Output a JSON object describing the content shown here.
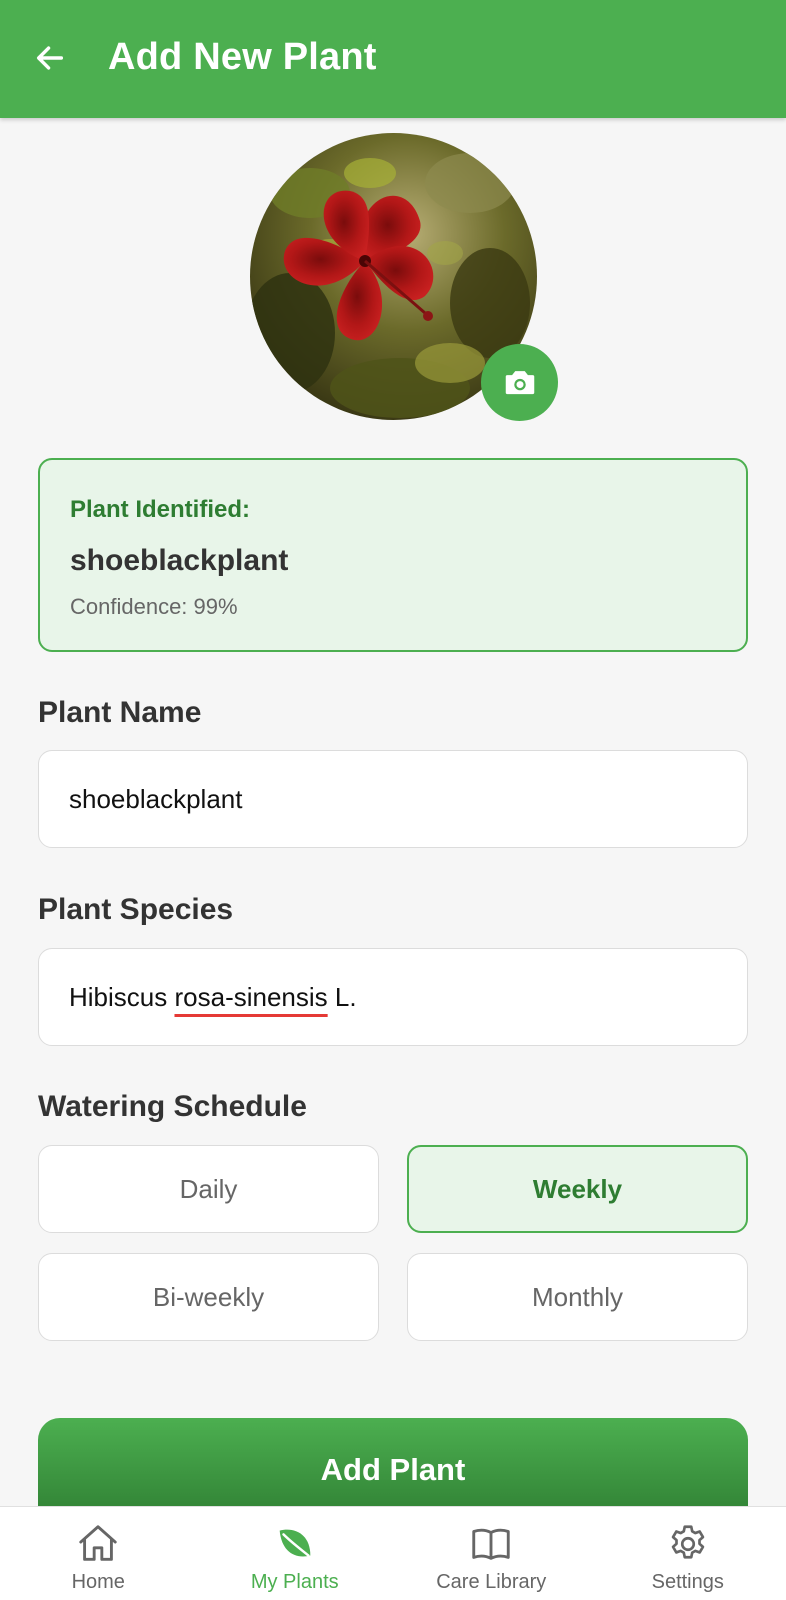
{
  "appbar": {
    "title": "Add New Plant",
    "back_icon": "arrow-left-icon"
  },
  "photo": {
    "alt": "Photo of a red hibiscus flower",
    "camera_icon": "camera-icon"
  },
  "identification": {
    "label": "Plant Identified:",
    "name": "shoeblackplant",
    "confidence": "Confidence: 99%"
  },
  "form": {
    "name_label": "Plant Name",
    "name_value": "shoeblackplant",
    "species_label": "Plant Species",
    "species_prefix": "Hibiscus ",
    "species_flagged": "rosa-sinensis",
    "species_suffix": " L.",
    "watering_label": "Watering Schedule",
    "watering_options": [
      "Daily",
      "Weekly",
      "Bi-weekly",
      "Monthly"
    ],
    "watering_selected": "Weekly"
  },
  "submit": {
    "label": "Add Plant"
  },
  "bottom_nav": [
    {
      "label": "Home",
      "icon": "home-icon"
    },
    {
      "label": "My Plants",
      "icon": "leaf-icon",
      "active": true
    },
    {
      "label": "Care Library",
      "icon": "book-icon"
    },
    {
      "label": "Settings",
      "icon": "gear-icon"
    }
  ],
  "colors": {
    "primary": "#4caf50",
    "primary_dark": "#2e7d32",
    "selected_bg": "#e8f5e9",
    "spellcheck": "#e53935"
  }
}
